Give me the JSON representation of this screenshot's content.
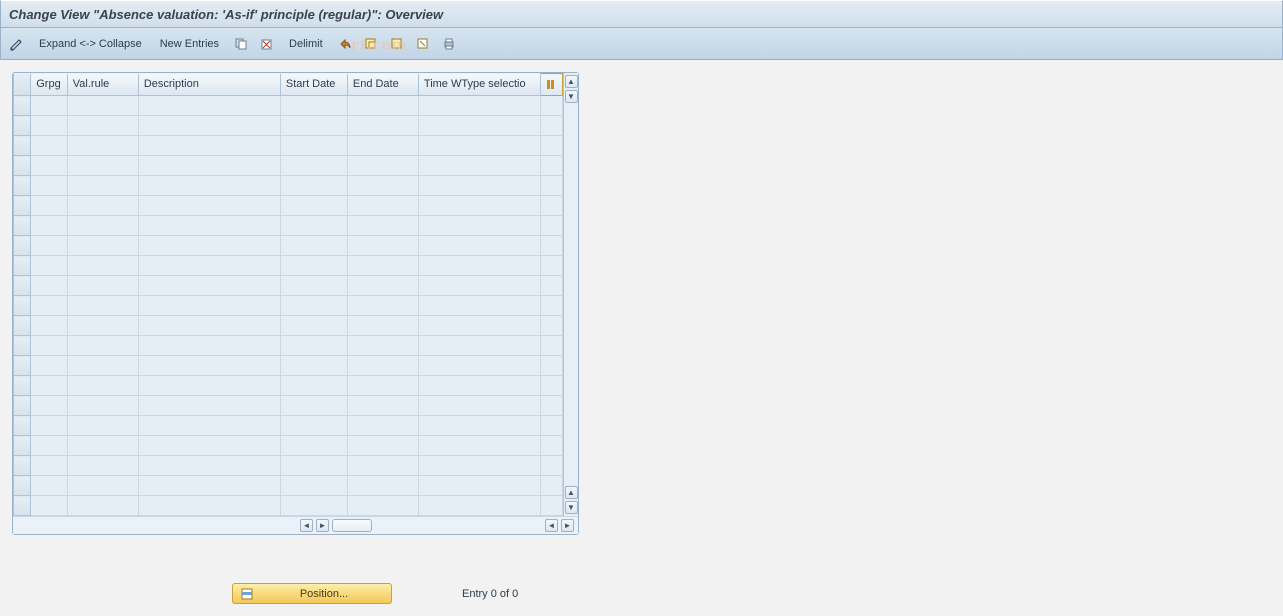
{
  "title": "Change View \"Absence valuation: 'As-if' principle (regular)\": Overview",
  "toolbar": {
    "expand_collapse": "Expand <-> Collapse",
    "new_entries": "New Entries",
    "delimit": "Delimit"
  },
  "columns": {
    "grpg": "Grpg",
    "valrule": "Val.rule",
    "description": "Description",
    "start_date": "Start Date",
    "end_date": "End Date",
    "time_wtype": "Time WType selectio"
  },
  "rows": [
    {},
    {},
    {},
    {},
    {},
    {},
    {},
    {},
    {},
    {},
    {},
    {},
    {},
    {},
    {},
    {},
    {},
    {},
    {},
    {},
    {}
  ],
  "position_button": "Position...",
  "entry_info": "Entry 0 of 0",
  "watermark": "rt.com"
}
